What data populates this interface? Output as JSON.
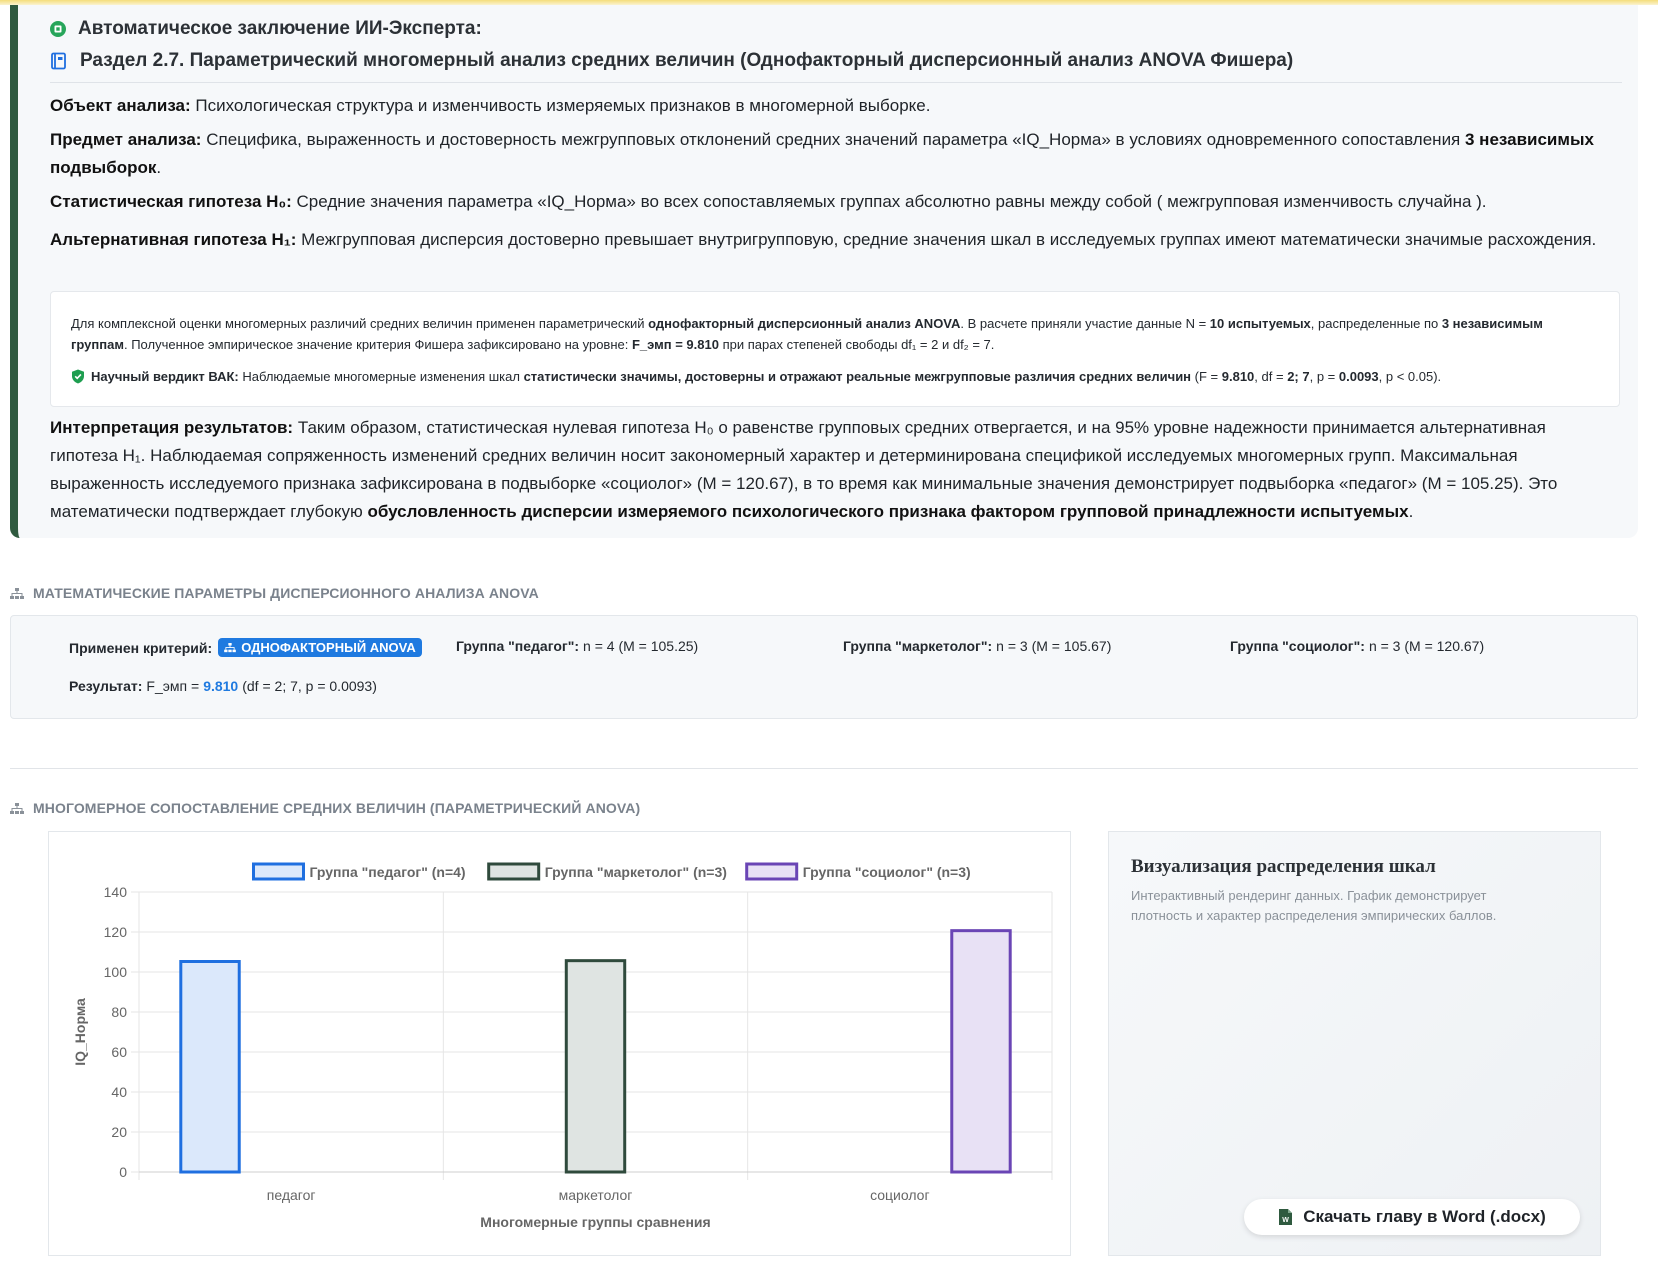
{
  "report": {
    "ai_title": "Автоматическое заключение ИИ-Эксперта:",
    "section_title": "Раздел 2.7. Параметрический многомерный анализ средних величин (Однофакторный дисперсионный анализ ANOVA Фишера)",
    "object_label": "Объект анализа:",
    "object_text": " Психологическая структура и изменчивость измеряемых признаков в многомерной выборке.",
    "subject_label": "Предмет анализа:",
    "subject_text": " Специфика, выраженность и достоверность межгрупповых отклонений средних значений параметра «IQ_Норма» в условиях одновременного сопоставления ",
    "subject_bold": "3 независимых подвыборок",
    "subject_end": ".",
    "h0_label": "Статистическая гипотеза H₀:",
    "h0_text": " Средние значения параметра «IQ_Норма» во всех сопоставляемых группах абсолютно равны между собой ( межгрупповая изменчивость случайна ).",
    "h1_label": "Альтернативная гипотеза H₁:",
    "h1_text": " Межгрупповая дисперсия достоверно превышает внутригрупповую, средние значения шкал в исследуемых группах имеют математически значимые расхождения.",
    "box": {
      "t1": "Для комплексной оценки многомерных различий средних величин применен параметрический ",
      "b1": "однофакторный дисперсионный анализ ANOVA",
      "t2": ". В расчете приняли участие данные N = ",
      "b2": "10 испытуемых",
      "t3": ", распределенные по ",
      "b3": "3 независимым группам",
      "t4": ". Полученное эмпирическое значение критерия Фишера зафиксировано на уровне: ",
      "b4": "F_эмп = 9.810",
      "t5": " при парах степеней свободы df₁ = 2 и df₂ = 7.",
      "v_label": "Научный вердикт ВАК:",
      "v_t1": " Наблюдаемые многомерные изменения шкал ",
      "v_b1": "статистически значимы, достоверны и отражают реальные межгрупповые различия средних величин",
      "v_t2": " (F = ",
      "v_b2": "9.810",
      "v_t3": ", df = ",
      "v_b3": "2; 7",
      "v_t4": ", p = ",
      "v_b4": "0.0093",
      "v_t5": ", p < 0.05)."
    },
    "interp_label": "Интерпретация результатов:",
    "interp_text": " Таким образом, статистическая нулевая гипотеза H₀ о равенстве групповых средних отвергается, и на 95% уровне надежности принимается альтернативная гипотеза H₁. Наблюдаемая сопряженность изменений средних величин носит закономерный характер и детерминирована спецификой исследуемых многомерных групп. Максимальная выраженность исследуемого признака зафиксирована в подвыборке «социолог» (M = 120.67), в то время как минимальные значения демонстрирует подвыборка «педагог» (M = 105.25). Это математически подтверждает глубокую ",
    "interp_bold": "обусловленность дисперсии измеряемого психологического признака фактором групповой принадлежности испытуемых",
    "interp_end": "."
  },
  "params": {
    "section_title": "МАТЕМАТИЧЕСКИЕ ПАРАМЕТРЫ ДИСПЕРСИОННОГО АНАЛИЗА ANOVA",
    "criterion_label": "Применен критерий:",
    "criterion_badge": "ОДНОФАКТОРНЫЙ ANOVA",
    "g1_label": "Группа \"педагог\":",
    "g1_value": "n = 4 (M = 105.25)",
    "g2_label": "Группа \"маркетолог\":",
    "g2_value": "n = 3 (M = 105.67)",
    "g3_label": "Группа \"социолог\":",
    "g3_value": "n = 3 (M = 120.67)",
    "result_label": "Результат:",
    "result_prefix": "F_эмп =",
    "result_f": "9.810",
    "result_suffix": "(df = 2; 7, p = 0.0093)"
  },
  "chart_section_title": "МНОГОМЕРНОЕ СОПОСТАВЛЕНИЕ СРЕДНИХ ВЕЛИЧИН (ПАРАМЕТРИЧЕСКИЙ ANOVA)",
  "chart_data": {
    "type": "bar",
    "categories": [
      "педагог",
      "маркетолог",
      "социолог"
    ],
    "series": [
      {
        "name": "Группа \"педагог\" (n=4)",
        "values": [
          105.25,
          null,
          null
        ],
        "color": "#1f6fe0",
        "fill": "#dbe8fb"
      },
      {
        "name": "Группа \"маркетолог\" (n=3)",
        "values": [
          null,
          105.67,
          null
        ],
        "color": "#2f4a3c",
        "fill": "#dfe4e2"
      },
      {
        "name": "Группа \"социолог\" (n=3)",
        "values": [
          null,
          null,
          120.67
        ],
        "color": "#6a45b5",
        "fill": "#e8e1f5"
      }
    ],
    "xlabel": "Многомерные группы сравнения",
    "ylabel": "IQ_Норма",
    "ylim": [
      0,
      140
    ],
    "yticks": [
      0,
      20,
      40,
      60,
      80,
      100,
      120,
      140
    ],
    "grid": true,
    "legend": "top"
  },
  "side": {
    "title": "Визуализация распределения шкал",
    "desc": "Интерактивный рендеринг данных. График демонстрирует плотность и характер распределения эмпирических баллов.",
    "download_label": "Скачать главу в Word (.docx)"
  },
  "colors": {
    "accent": "#1f7ae0",
    "report_border": "#2f5a3f",
    "verdict_icon": "#1e9e50"
  }
}
